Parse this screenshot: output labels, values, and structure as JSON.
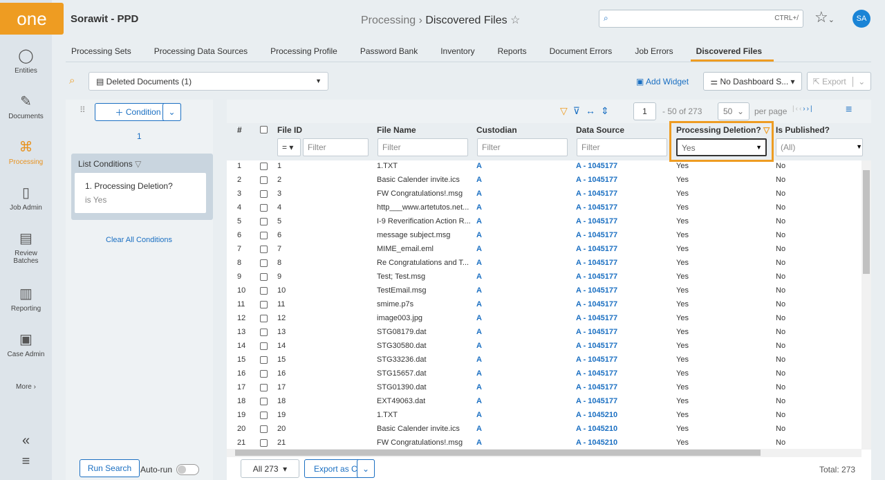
{
  "app": {
    "logo": "one",
    "project": "Sorawit - PPD",
    "breadcrumb_parent": "Processing",
    "breadcrumb_current": "Discovered Files",
    "search_shortcut": "CTRL+/",
    "avatar": "SA"
  },
  "sidebar": {
    "items": [
      {
        "label": "Entities",
        "icon": "person-icon"
      },
      {
        "label": "Documents",
        "icon": "document-icon"
      },
      {
        "label": "Processing",
        "icon": "processing-icon"
      },
      {
        "label": "Job Admin",
        "icon": "book-icon"
      },
      {
        "label": "Review Batches",
        "icon": "batches-icon"
      },
      {
        "label": "Reporting",
        "icon": "chart-icon"
      },
      {
        "label": "Case Admin",
        "icon": "case-icon"
      }
    ],
    "more": "More"
  },
  "tabs": [
    "Processing Sets",
    "Processing Data Sources",
    "Processing Profile",
    "Password Bank",
    "Inventory",
    "Reports",
    "Document Errors",
    "Job Errors",
    "Discovered Files"
  ],
  "active_tab": "Discovered Files",
  "toolbar": {
    "saved_search": "Deleted Documents (1)",
    "add_widget": "Add Widget",
    "dashboard": "No Dashboard S...",
    "export": "Export"
  },
  "conditions": {
    "add_label": "Condition",
    "count": "1",
    "list_title": "List Conditions",
    "items": [
      {
        "title": "1. Processing Deletion?",
        "value": "is Yes"
      }
    ],
    "clear": "Clear All Conditions",
    "run": "Run Search",
    "autorun": "Auto-run"
  },
  "pager": {
    "page": "1",
    "range": "- 50  of  273",
    "per_page": "50",
    "per_page_label": "per page"
  },
  "columns": [
    "#",
    "File ID",
    "File Name",
    "Custodian",
    "Data Source",
    "Processing Deletion?",
    "Is Published?"
  ],
  "filters": {
    "op": "=",
    "placeholder": "Filter",
    "deletion": "Yes",
    "published": "(All)"
  },
  "rows": [
    [
      "1",
      "1",
      "1.TXT",
      "A",
      "A - 1045177",
      "Yes",
      "No"
    ],
    [
      "2",
      "2",
      "Basic Calender invite.ics",
      "A",
      "A - 1045177",
      "Yes",
      "No"
    ],
    [
      "3",
      "3",
      "FW Congratulations!.msg",
      "A",
      "A - 1045177",
      "Yes",
      "No"
    ],
    [
      "4",
      "4",
      "http___www.artetutos.net...",
      "A",
      "A - 1045177",
      "Yes",
      "No"
    ],
    [
      "5",
      "5",
      "I-9 Reverification Action R...",
      "A",
      "A - 1045177",
      "Yes",
      "No"
    ],
    [
      "6",
      "6",
      "message subject.msg",
      "A",
      "A - 1045177",
      "Yes",
      "No"
    ],
    [
      "7",
      "7",
      "MIME_email.eml",
      "A",
      "A - 1045177",
      "Yes",
      "No"
    ],
    [
      "8",
      "8",
      "Re Congratulations and T...",
      "A",
      "A - 1045177",
      "Yes",
      "No"
    ],
    [
      "9",
      "9",
      "Test; Test.msg",
      "A",
      "A - 1045177",
      "Yes",
      "No"
    ],
    [
      "10",
      "10",
      "TestEmail.msg",
      "A",
      "A - 1045177",
      "Yes",
      "No"
    ],
    [
      "11",
      "11",
      "smime.p7s",
      "A",
      "A - 1045177",
      "Yes",
      "No"
    ],
    [
      "12",
      "12",
      "image003.jpg",
      "A",
      "A - 1045177",
      "Yes",
      "No"
    ],
    [
      "13",
      "13",
      "STG08179.dat",
      "A",
      "A - 1045177",
      "Yes",
      "No"
    ],
    [
      "14",
      "14",
      "STG30580.dat",
      "A",
      "A - 1045177",
      "Yes",
      "No"
    ],
    [
      "15",
      "15",
      "STG33236.dat",
      "A",
      "A - 1045177",
      "Yes",
      "No"
    ],
    [
      "16",
      "16",
      "STG15657.dat",
      "A",
      "A - 1045177",
      "Yes",
      "No"
    ],
    [
      "17",
      "17",
      "STG01390.dat",
      "A",
      "A - 1045177",
      "Yes",
      "No"
    ],
    [
      "18",
      "18",
      "EXT49063.dat",
      "A",
      "A - 1045177",
      "Yes",
      "No"
    ],
    [
      "19",
      "19",
      "1.TXT",
      "A",
      "A - 1045210",
      "Yes",
      "No"
    ],
    [
      "20",
      "20",
      "Basic Calender invite.ics",
      "A",
      "A - 1045210",
      "Yes",
      "No"
    ],
    [
      "21",
      "21",
      "FW Congratulations!.msg",
      "A",
      "A - 1045210",
      "Yes",
      "No"
    ]
  ],
  "footer": {
    "scope": "All 273",
    "export_as": "Export as CSV",
    "total": "Total: 273"
  },
  "colors": {
    "accent": "#ee9c22",
    "link": "#1a6fc2"
  }
}
